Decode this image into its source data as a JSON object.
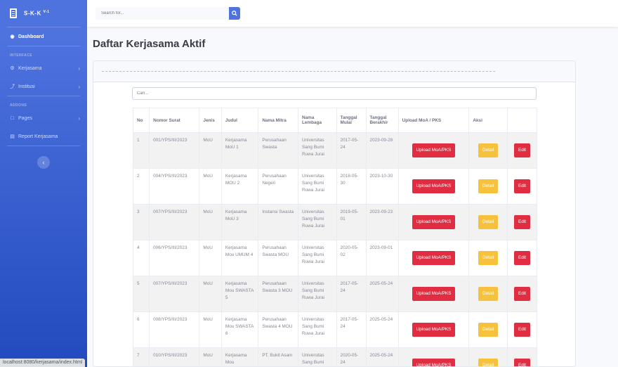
{
  "sidebar": {
    "brand": "S-K-K",
    "brand_version": "V-1",
    "items": [
      {
        "label": "Dashboard",
        "icon": "tachometer-icon"
      },
      {
        "heading": "INTERFACE"
      },
      {
        "label": "Kerjasama",
        "icon": "gear-icon"
      },
      {
        "label": "Institusi",
        "icon": "wrench-icon"
      },
      {
        "heading": "ADDONS"
      },
      {
        "label": "Pages",
        "icon": "folder-icon"
      },
      {
        "label": "Report Kerjasama",
        "icon": "chart-icon"
      }
    ],
    "status_url": "localhost:8080/kerjasama/index.html"
  },
  "topbar": {
    "search_placeholder": "Search for..."
  },
  "page": {
    "title": "Daftar Kerjasama Aktif",
    "filter_placeholder": "Cari..."
  },
  "table": {
    "headers": [
      "No",
      "Nomor Surat",
      "Jenis",
      "Judul",
      "Nama Mitra",
      "Nama Lembaga",
      "Tanggal Mulai",
      "Tanggal Berakhir",
      "Upload MoA / PKS",
      "Aksi",
      ""
    ],
    "upload_label": "Upload MoA/PKS",
    "detail_label": "Detail",
    "edit_label": "Edit",
    "rows": [
      {
        "no": "1",
        "nomor": "001/YPS/III/2023",
        "jenis": "MoU",
        "judul": "Kerjasama MoU 1",
        "mitra": "Perusahaan Swasta",
        "lembaga": "Universitas Sang Bumi Ruwa Jurai",
        "mulai": "2017-05-24",
        "akhir": "2023-09-28"
      },
      {
        "no": "2",
        "nomor": "004/YPS/III/2023",
        "jenis": "MoU",
        "judul": "Kerjasama MOU 2",
        "mitra": "Perusahaan Negeri",
        "lembaga": "Universitas Sang Bumi Ruwa Jurai",
        "mulai": "2018-05-30",
        "akhir": "2023-10-30"
      },
      {
        "no": "3",
        "nomor": "007/YPS/III/2023",
        "jenis": "MoU",
        "judul": "Kerjasama MoU 3",
        "mitra": "Instansi Swasta",
        "lembaga": "Universitas Sang Bumi Ruwa Jurai",
        "mulai": "2019-05-01",
        "akhir": "2023-09-23"
      },
      {
        "no": "4",
        "nomor": "006/YPS/III/2023",
        "jenis": "MoU",
        "judul": "Kerjasama Mou UMUM 4",
        "mitra": "Perusahaan Swasta MOU",
        "lembaga": "Universitas Sang Bumi Ruwa Jurai",
        "mulai": "2020-05-02",
        "akhir": "2023-09-01"
      },
      {
        "no": "5",
        "nomor": "007/YPS/III/2023",
        "jenis": "MoU",
        "judul": "Kerjasama Mou SWASTA 5",
        "mitra": "Perusahaan Swasta 3 MOU",
        "lembaga": "Universitas Sang Bumi Ruwa Jurai",
        "mulai": "2017-05-24",
        "akhir": "2025-05-24"
      },
      {
        "no": "6",
        "nomor": "008/YPS/III/2023",
        "jenis": "MoU",
        "judul": "Kerjasama Mou SWASTA 6",
        "mitra": "Perusahaan Swasta 4 MOU",
        "lembaga": "Universitas Sang Bumi Ruwa Jurai",
        "mulai": "2017-05-24",
        "akhir": "2025-05-24"
      },
      {
        "no": "7",
        "nomor": "010/YPS/III/2023",
        "jenis": "MoU",
        "judul": "Kerjasama Mou",
        "mitra": "PT. Bukit Asam",
        "lembaga": "Universitas Sang Bumi",
        "mulai": "2020-05-24",
        "akhir": "2025-05-24"
      }
    ]
  },
  "colors": {
    "sidebar_top": "#4e73df",
    "sidebar_bottom": "#224abe",
    "danger": "#e02d42",
    "warning": "#f6c23e"
  }
}
